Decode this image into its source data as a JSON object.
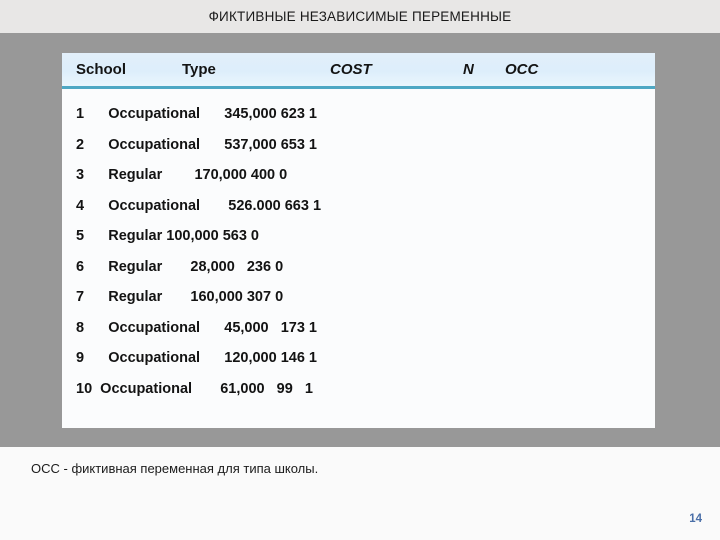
{
  "slide": {
    "title": "ФИКТИВНЫЕ НЕЗАВИСИМЫЕ ПЕРЕМЕННЫЕ",
    "caption": "OCC - фиктивная переменная для типа школы.",
    "number": "14",
    "colors": {
      "title_bar": "#e8e7e6",
      "backdrop": "#989898",
      "panel": "#fbfcfd",
      "header_gradient_top": "#e2effa",
      "header_gradient_bottom": "#eaf6fd",
      "header_rule": "#4ea8c4",
      "text": "#131313",
      "slide_number": "#4a6fa8"
    }
  },
  "table": {
    "headers": [
      {
        "label": "School",
        "italic": false
      },
      {
        "label": "Type",
        "italic": false
      },
      {
        "label": "COST",
        "italic": true
      },
      {
        "label": "N",
        "italic": true
      },
      {
        "label": "OCC",
        "italic": true
      }
    ],
    "rows": [
      {
        "school": "1",
        "type": "Occupational",
        "cost": "345,000",
        "n": "623",
        "occ": "1",
        "line": "1      Occupational      345,000 623 1"
      },
      {
        "school": "2",
        "type": "Occupational",
        "cost": "537,000",
        "n": "653",
        "occ": "1",
        "line": "2      Occupational      537,000 653 1"
      },
      {
        "school": "3",
        "type": "Regular",
        "cost": "170,000",
        "n": "400",
        "occ": "0",
        "line": "3      Regular        170,000 400 0"
      },
      {
        "school": "4",
        "type": "Occupational",
        "cost": "526.000",
        "n": "663",
        "occ": "1",
        "line": "4      Occupational       526.000 663 1"
      },
      {
        "school": "5",
        "type": "Regular",
        "cost": "100,000",
        "n": "563",
        "occ": "0",
        "line": "5      Regular 100,000 563 0"
      },
      {
        "school": "6",
        "type": "Regular",
        "cost": "28,000",
        "n": "236",
        "occ": "0",
        "line": "6      Regular       28,000   236 0"
      },
      {
        "school": "7",
        "type": "Regular",
        "cost": "160,000",
        "n": "307",
        "occ": "0",
        "line": "7      Regular       160,000 307 0"
      },
      {
        "school": "8",
        "type": "Occupational",
        "cost": "45,000",
        "n": "173",
        "occ": "1",
        "line": "8      Occupational      45,000   173 1"
      },
      {
        "school": "9",
        "type": "Occupational",
        "cost": "120,000",
        "n": "146",
        "occ": "1",
        "line": "9      Occupational      120,000 146 1"
      },
      {
        "school": "10",
        "type": "Occupational",
        "cost": "61,000",
        "n": "99",
        "occ": "1",
        "line": "10  Occupational       61,000   99   1"
      }
    ]
  }
}
